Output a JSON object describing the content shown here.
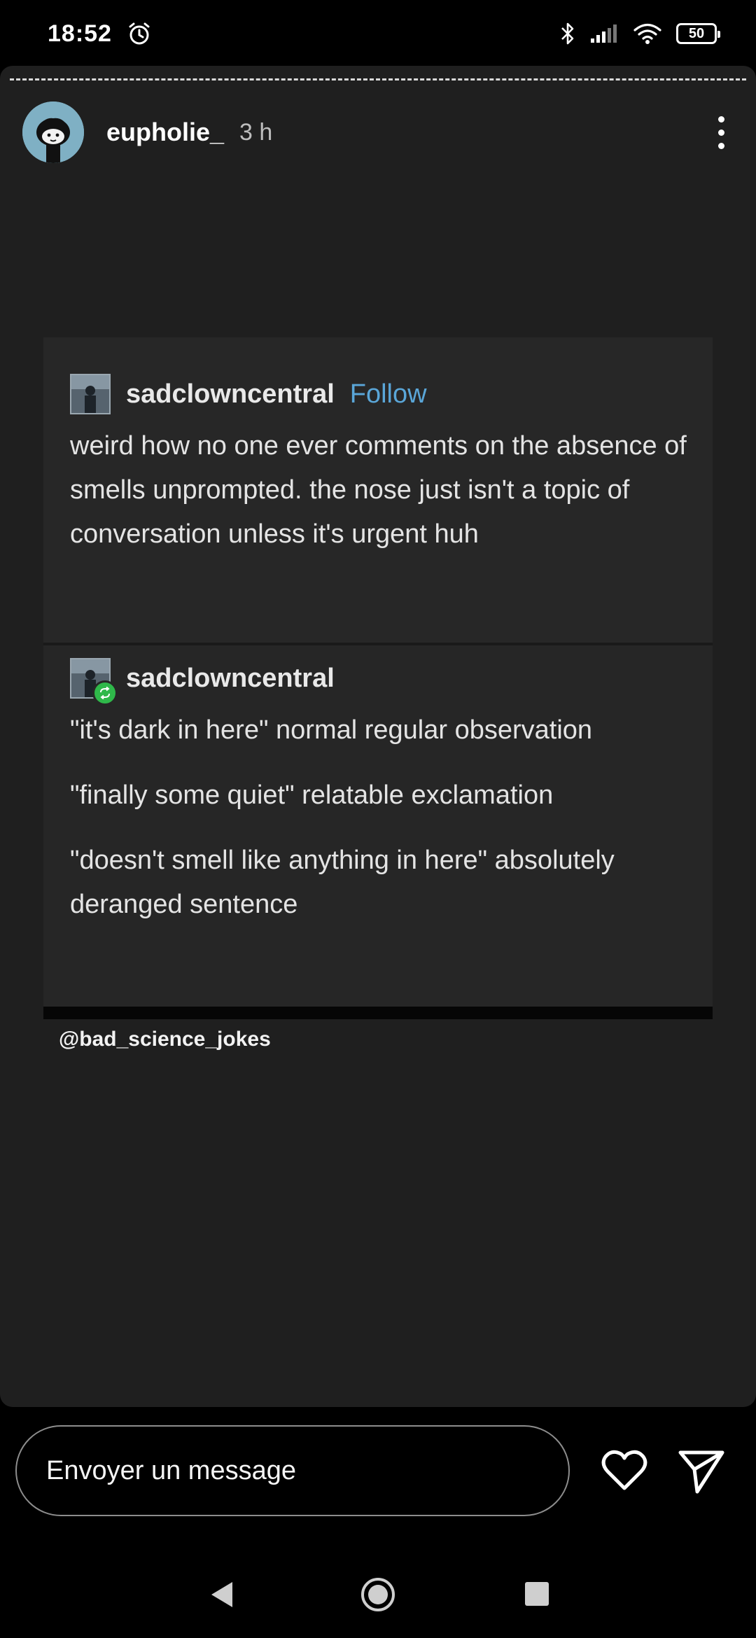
{
  "status_bar": {
    "time": "18:52",
    "battery_level": "50",
    "icons": [
      "alarm-icon",
      "bluetooth-icon",
      "signal-icon",
      "wifi-icon",
      "battery-icon"
    ]
  },
  "story": {
    "username": "eupholie_",
    "time_ago": "3 h",
    "more_icon": "more-vertical-icon"
  },
  "post": {
    "original": {
      "author": "sadclowncentral",
      "follow_label": "Follow",
      "text": "weird how no one ever comments on the absence of smells unprompted. the nose just isn't a topic of conversation unless it's urgent huh"
    },
    "reblog": {
      "author": "sadclowncentral",
      "lines": [
        "\"it's dark in here\" normal regular observation",
        "\"finally some quiet\" relatable exclamation",
        "\"doesn't smell like anything in here\" absolutely deranged sentence"
      ]
    },
    "mention": "@bad_science_jokes"
  },
  "reply": {
    "placeholder": "Envoyer un message",
    "like_icon": "heart-icon",
    "share_icon": "send-icon"
  },
  "navbar": {
    "icons": [
      "back-icon",
      "home-icon",
      "recents-icon"
    ]
  },
  "colors": {
    "story_bg": "#1f1f1f",
    "post_bg": "#272727",
    "follow": "#5aa6d8",
    "reblog_badge": "#2fb84a"
  }
}
